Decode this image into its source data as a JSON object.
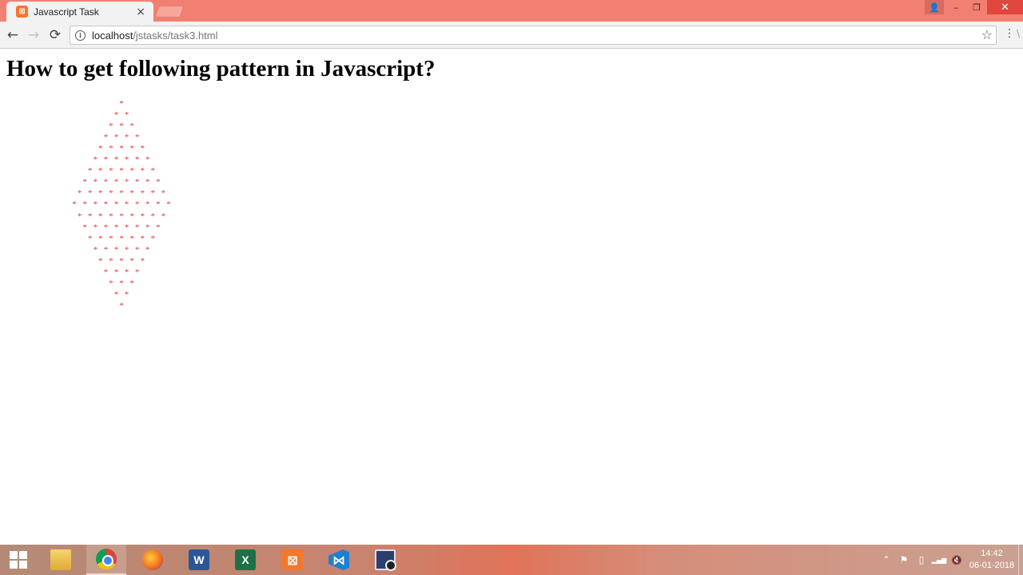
{
  "browser": {
    "tab": {
      "favicon": "xampp-icon",
      "favicon_glyph": "⊠",
      "title": "Javascript Task",
      "close_glyph": "×"
    },
    "window_controls": {
      "profile_glyph": "👤",
      "minimize_glyph": "–",
      "restore_glyph": "❐",
      "close_glyph": "✕"
    },
    "toolbar": {
      "back_glyph": "←",
      "forward_glyph": "→",
      "reload_glyph": "⟳",
      "info_glyph": "i",
      "url_host": "localhost",
      "url_path": "/jstasks/task3.html",
      "bookmark_glyph": "☆",
      "menu_glyph": "⋮",
      "extension_glyph": "\\"
    }
  },
  "page": {
    "heading": "How to get following pattern in Javascript?",
    "pattern": {
      "glyph": "*",
      "color": "#e0393b",
      "row_counts": [
        1,
        2,
        3,
        4,
        5,
        6,
        7,
        8,
        9,
        10,
        9,
        8,
        7,
        6,
        5,
        4,
        3,
        2,
        1
      ]
    }
  },
  "taskbar": {
    "apps": [
      {
        "name": "file-explorer",
        "icon": "folder-icon",
        "glyph": ""
      },
      {
        "name": "chrome",
        "icon": "chrome-icon",
        "glyph": "",
        "active": true
      },
      {
        "name": "firefox",
        "icon": "firefox-icon",
        "glyph": ""
      },
      {
        "name": "word",
        "icon": "word-icon",
        "glyph": "W"
      },
      {
        "name": "excel",
        "icon": "excel-icon",
        "glyph": "X"
      },
      {
        "name": "xampp",
        "icon": "xampp-icon",
        "glyph": "⊠"
      },
      {
        "name": "vscode",
        "icon": "vscode-icon",
        "glyph": "⋈"
      },
      {
        "name": "screen-recorder",
        "icon": "recorder-icon",
        "glyph": ""
      }
    ],
    "tray": {
      "chevron_glyph": "⌃",
      "flag_glyph": "⚑",
      "battery_glyph": "▯",
      "network_glyph": "▂▄▆",
      "volume_glyph": "🔇",
      "time": "14:42",
      "date": "06-01-2018"
    }
  }
}
